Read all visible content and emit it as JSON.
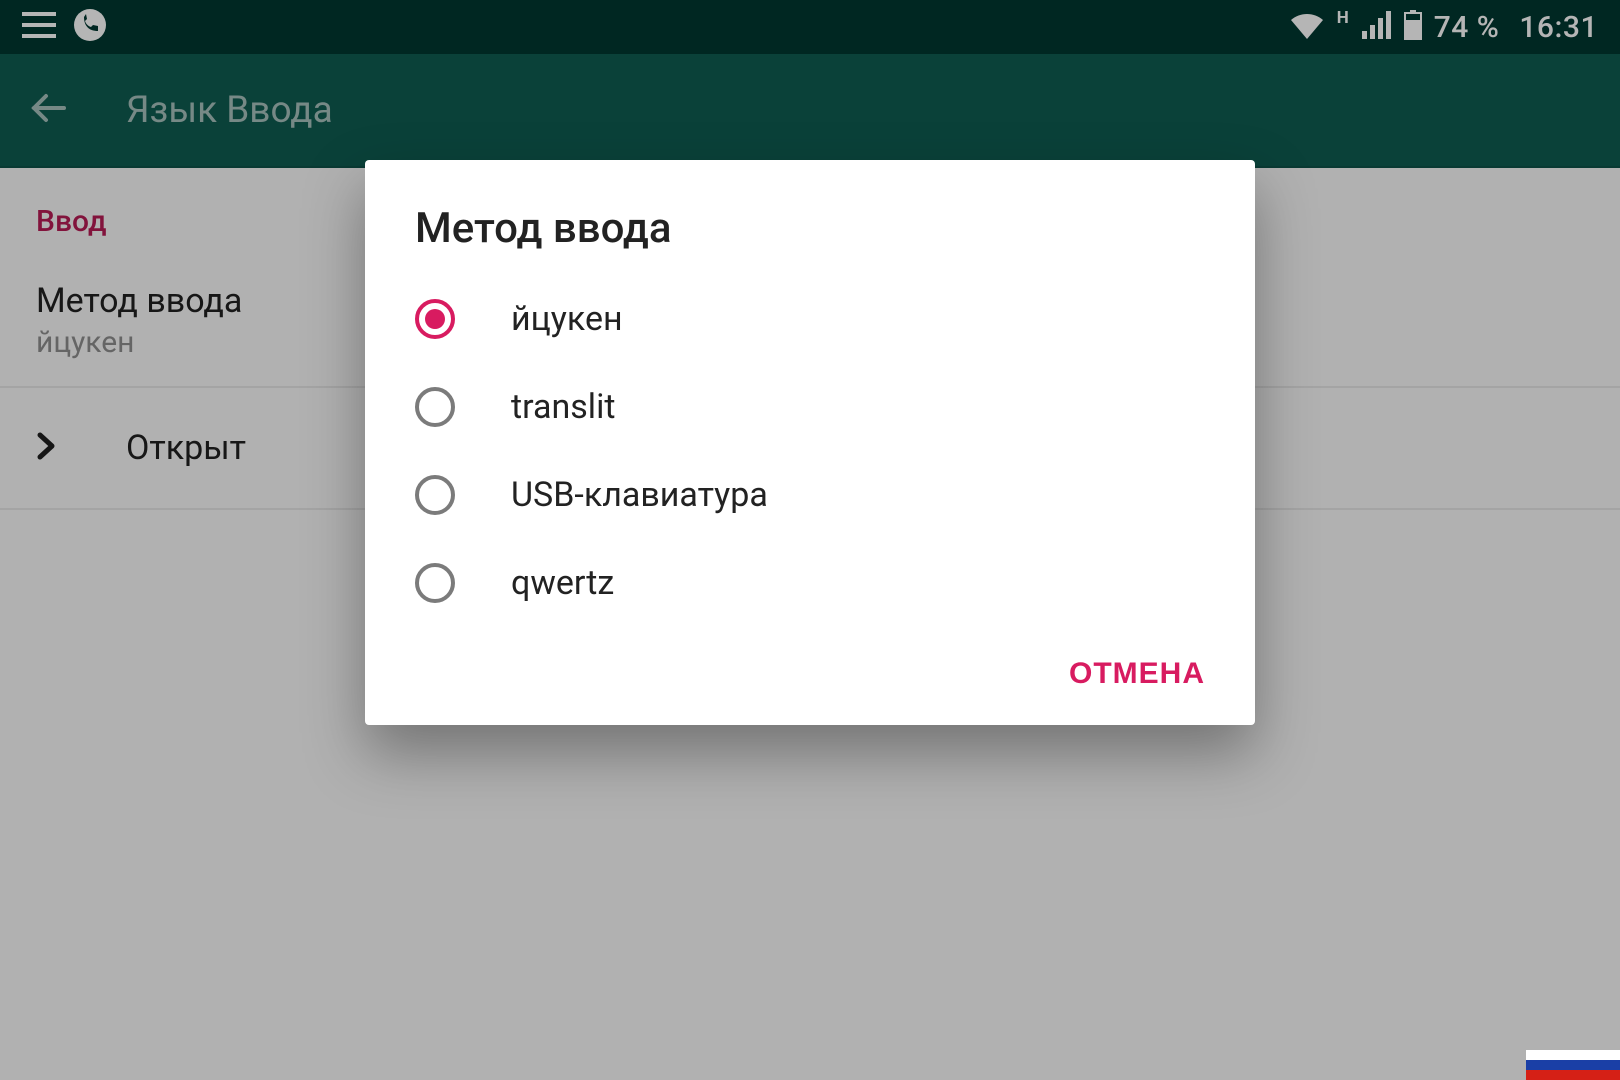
{
  "status": {
    "network_label": "H",
    "battery_text": "74 %",
    "time": "16:31"
  },
  "appbar": {
    "title": "Язык Ввода"
  },
  "section_header": "Ввод",
  "setting": {
    "title": "Метод ввода",
    "value": "йцукен"
  },
  "nav_row": {
    "label": "Открыт"
  },
  "dialog": {
    "title": "Метод ввода",
    "options": [
      {
        "label": "йцукен",
        "selected": true
      },
      {
        "label": "translit",
        "selected": false
      },
      {
        "label": "USB-клавиатура",
        "selected": false
      },
      {
        "label": "qwertz",
        "selected": false
      }
    ],
    "cancel": "ОТМЕНА"
  },
  "colors": {
    "accent": "#d81b60",
    "appbar": "#0f5c51",
    "statusbar": "#003731"
  }
}
